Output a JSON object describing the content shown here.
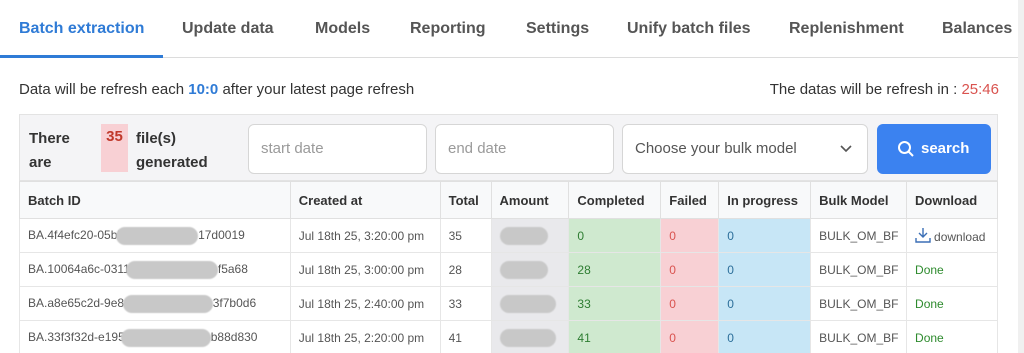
{
  "tabs": [
    {
      "label": "Batch extraction",
      "active": true
    },
    {
      "label": "Update data"
    },
    {
      "label": "Models"
    },
    {
      "label": "Reporting"
    },
    {
      "label": "Settings"
    },
    {
      "label": "Unify batch files"
    },
    {
      "label": "Replenishment"
    },
    {
      "label": "Balances"
    }
  ],
  "info": {
    "prefix": "Data will be refresh each ",
    "interval": "10:0",
    "suffix": " after your latest page refresh",
    "countdown_label": "The datas will be refresh in : ",
    "countdown": "25:46"
  },
  "filter": {
    "there_are": "There are",
    "count": "35",
    "files_label": "file(s) generated",
    "start_placeholder": "start date",
    "end_placeholder": "end date",
    "model_select": "Choose your bulk model",
    "search_label": "search"
  },
  "table": {
    "headers": [
      "Batch ID",
      "Created at",
      "Total",
      "Amount",
      "Completed",
      "Failed",
      "In progress",
      "Bulk Model",
      "Download"
    ],
    "rows": [
      {
        "id_start": "BA.4f4efc20-05bb",
        "id_end": "17d0019",
        "created": "Jul 18th 25, 3:20:00 pm",
        "total": "35",
        "completed": "0",
        "failed": "0",
        "in_progress": "0",
        "model": "BULK_OM_BF",
        "download": "download"
      },
      {
        "id_start": "BA.10064a6c-0311-",
        "id_end": "f5a68",
        "created": "Jul 18th 25, 3:00:00 pm",
        "total": "28",
        "completed": "28",
        "failed": "0",
        "in_progress": "0",
        "model": "BULK_OM_BF",
        "download": "Done"
      },
      {
        "id_start": "BA.a8e65c2d-9e8a",
        "id_end": "3f7b0d6",
        "created": "Jul 18th 25, 2:40:00 pm",
        "total": "33",
        "completed": "33",
        "failed": "0",
        "in_progress": "0",
        "model": "BULK_OM_BF",
        "download": "Done"
      },
      {
        "id_start": "BA.33f3f32d-e195-",
        "id_end": "b88d830",
        "created": "Jul 18th 25, 2:20:00 pm",
        "total": "41",
        "completed": "41",
        "failed": "0",
        "in_progress": "0",
        "model": "BULK_OM_BF",
        "download": "Done"
      }
    ]
  },
  "colors": {
    "accent": "#2f7bd6",
    "button": "#3b82f0",
    "completed_bg": "#cfe9cf",
    "failed_bg": "#f8d0d4",
    "progress_bg": "#c7e6f6"
  },
  "icons": {
    "search": "search-icon",
    "chevron": "chevron-down-icon",
    "download": "download-icon"
  }
}
